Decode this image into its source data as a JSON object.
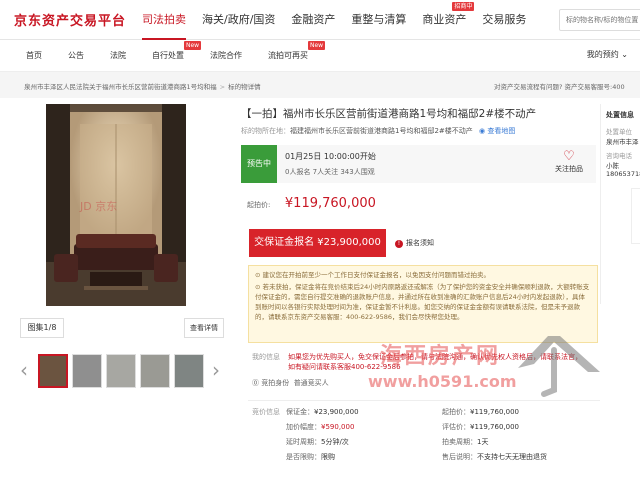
{
  "header": {
    "logo": "京东资产交易平台",
    "nav": [
      {
        "label": "司法拍卖",
        "active": true
      },
      {
        "label": "海关/政府/国资"
      },
      {
        "label": "金融资产"
      },
      {
        "label": "重整与清算"
      },
      {
        "label": "商业资产",
        "badge": "招商中"
      },
      {
        "label": "交易服务"
      }
    ],
    "search_placeholder": "标的物名称/标的物位置"
  },
  "subnav": {
    "items": [
      {
        "label": "首页"
      },
      {
        "label": "公告"
      },
      {
        "label": "法院"
      },
      {
        "label": "自行处置",
        "badge": "New"
      },
      {
        "label": "法院合作"
      },
      {
        "label": "流拍可再买",
        "badge": "New"
      }
    ],
    "my_browse": "我的预约"
  },
  "breadcrumb": {
    "items": [
      "泉州市丰泽区人民法院关于福州市长乐区营前街道港商路1号均和福",
      "标的物详情"
    ],
    "help_text": "对资产交易流程有问题? 资产交易客服号:400"
  },
  "gallery": {
    "photo_count": "图集1/8",
    "detail_label": "查看详情",
    "prev_arrow": "‹",
    "next_arrow": "›",
    "photo_watermark": "JD 京东"
  },
  "lot": {
    "title": "【一拍】福州市长乐区营前街道港商路1号均和福邸2#楼不动产",
    "location_label": "标的物所在地：",
    "location_value": "福建福州市长乐区营前街道港商路1号均和福邸2#楼不动产",
    "map_link": "查看地图",
    "status_tag": "预告中",
    "start_time": "01月25日 10:00:00开始",
    "counts": "0人报名  7人关注  343人围观",
    "follow_label": "关注拍品",
    "start_price_label": "起拍价:",
    "start_price": "¥119,760,000",
    "deposit_button": "交保证金报名 ¥23,900,000",
    "notice_label": "报名须知"
  },
  "tips": [
    "建议您在开拍前至少一个工作日支付保证金报名，以免因支付问题而错过拍卖。",
    "若未获拍，保证金将在竞价结束后24小时内原路返还或解冻（为了保护您的资金安全并确保顺利退款，大额转账支付保证金的，需您自行提交准确的退款账户信息，并通过所在收到准确的汇款账户信息后24小时内发起退款），具体到账时间以各银行实际处理时间为准，保证金暂不计利息。如您交纳的保证金金额有误请联系法院，但是未予退款的，请联系京东资产交易客服：400-622-9586，我们会尽快帮您处理。"
  ],
  "my_info": {
    "label": "我的信息",
    "notice": "如果您为优先购买人，免交保证金后参拍，请与法院沟通，确认优先权人资格后，请联系法官，如有疑问请联系客服400-622-9586",
    "identity_label": "竞拍身份",
    "identity_value": "普通竞买人"
  },
  "auction_info": {
    "section_label": "竞价信息",
    "left": [
      {
        "k": "保证金：",
        "v": "¥23,900,000",
        "red": false
      },
      {
        "k": "加价幅度：",
        "v": "¥590,000",
        "red": true
      },
      {
        "k": "延时周期：",
        "v": "5分钟/次",
        "red": false
      },
      {
        "k": "是否限购：",
        "v": "限购",
        "red": false
      }
    ],
    "right": [
      {
        "k": "起拍价：",
        "v": "¥119,760,000"
      },
      {
        "k": "评估价：",
        "v": "¥119,760,000"
      },
      {
        "k": "拍卖周期：",
        "v": "1天"
      },
      {
        "k": "售后说明：",
        "v": "不支持七天无理由退货"
      }
    ]
  },
  "sidebar": {
    "heading": "处置信息",
    "court_label": "处置单位",
    "court": "泉州市丰泽",
    "contact_label": "咨询电话",
    "contact_name": "小陈",
    "phone": "18065371877"
  },
  "watermark": {
    "cn": "海西房产网",
    "url": "www.h0591.com"
  },
  "colors": {
    "brand_red": "#c81623",
    "status_green": "#3a9c3a",
    "tip_bg": "#fff8e1"
  }
}
